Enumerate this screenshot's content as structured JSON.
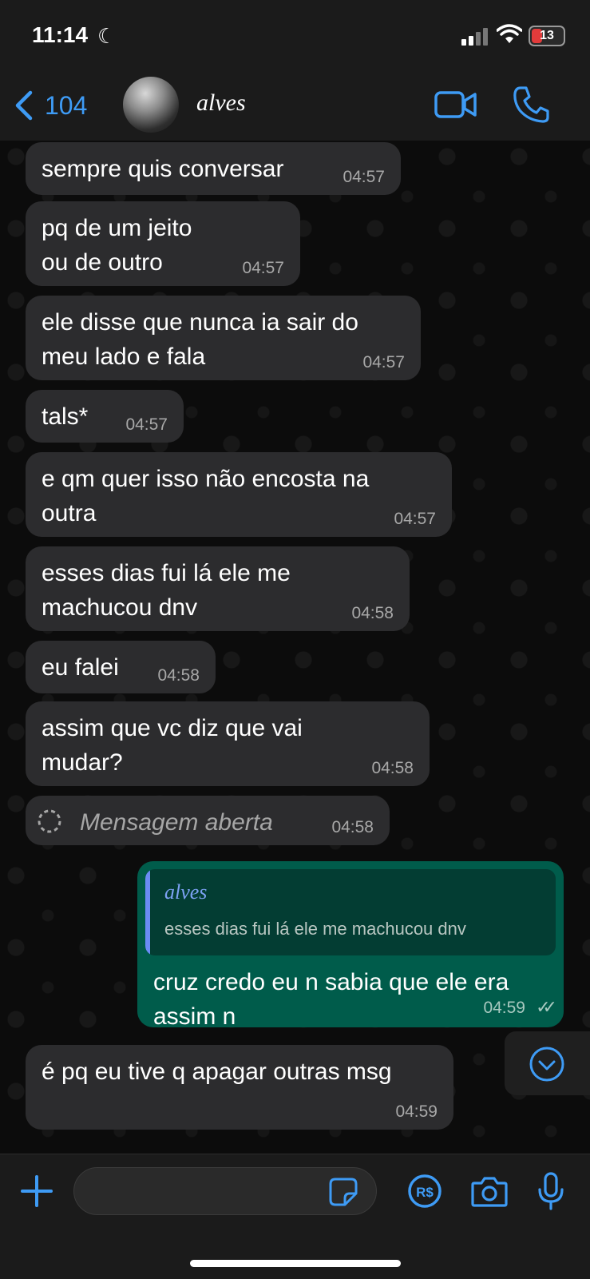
{
  "status_bar": {
    "time": "11:14",
    "battery": "13"
  },
  "header": {
    "back_count": "104",
    "contact_name": "alves"
  },
  "messages": [
    {
      "text": "sempre quis conversar",
      "time": "04:57"
    },
    {
      "text": "pq de um jeito\nou de outro",
      "time": "04:57"
    },
    {
      "text": "ele disse que nunca ia sair do\nmeu lado e fala",
      "time": "04:57"
    },
    {
      "text": "tals*",
      "time": "04:57"
    },
    {
      "text": "e qm quer isso não encosta na\noutra",
      "time": "04:57"
    },
    {
      "text": "esses dias fui lá ele me\nmachucou dnv",
      "time": "04:58"
    },
    {
      "text": "eu falei",
      "time": "04:58"
    },
    {
      "text": "assim que vc diz que vai\nmudar?",
      "time": "04:58"
    }
  ],
  "deleted_message": {
    "text": "Mensagem aberta",
    "time": "04:58"
  },
  "sent_message": {
    "quote_name": "alves",
    "quote_text": "esses dias fui lá ele me machucou dnv",
    "text": "cruz credo eu n sabia que ele era\nassim n",
    "time": "04:59"
  },
  "last_message": {
    "text": "é pq eu tive q apagar outras msg",
    "time": "04:59"
  }
}
